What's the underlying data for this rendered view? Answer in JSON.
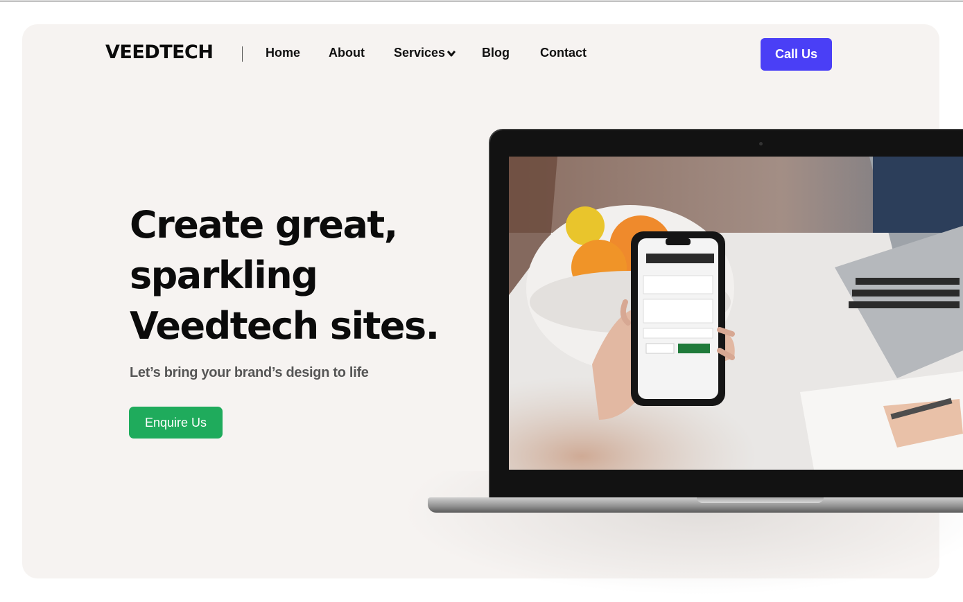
{
  "brand": {
    "logo_text": "VEEDTECH"
  },
  "nav": {
    "items": [
      {
        "label": "Home"
      },
      {
        "label": "About"
      },
      {
        "label": "Services",
        "icon": "chevron-down-icon"
      },
      {
        "label": "Blog"
      },
      {
        "label": "Contact"
      }
    ],
    "cta_label": "Call Us"
  },
  "hero": {
    "title_lines": [
      "Create great,",
      "sparkling",
      "Veedtech sites."
    ],
    "subtitle": "Let’s bring your brand’s design to life",
    "cta_label": "Enquire Us"
  },
  "colors": {
    "background": "#f6f3f1",
    "call_button": "#4a3ff6",
    "enquire_button": "#1fab5c",
    "text": "#0b0b0b"
  },
  "image": {
    "description_icon": "laptop-mockup"
  }
}
